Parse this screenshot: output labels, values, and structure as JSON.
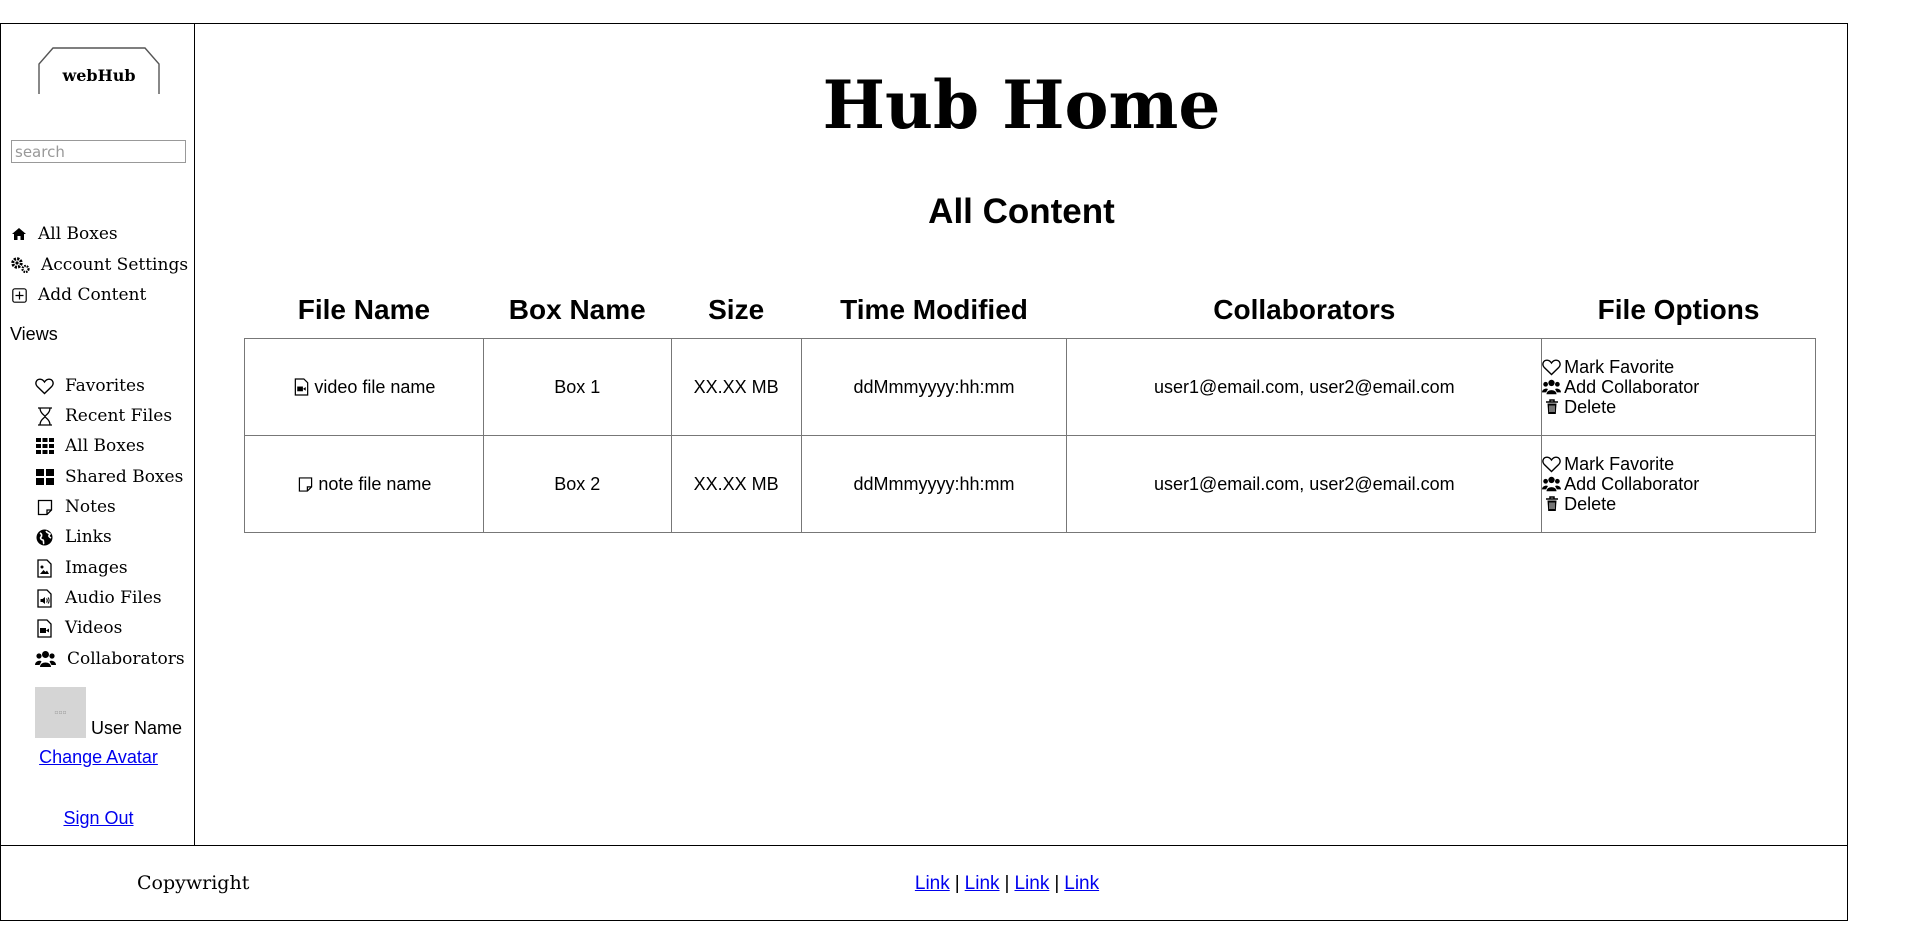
{
  "sidebar": {
    "logo_text": "webHub",
    "search_placeholder": "search",
    "nav": [
      {
        "label": "All Boxes",
        "icon": "home-icon"
      },
      {
        "label": "Account Settings",
        "icon": "gears-icon"
      },
      {
        "label": "Add Content",
        "icon": "plus-square-icon"
      }
    ],
    "views_label": "Views",
    "views": [
      {
        "label": "Favorites",
        "icon": "heart-icon"
      },
      {
        "label": "Recent Files",
        "icon": "hourglass-icon"
      },
      {
        "label": "All Boxes",
        "icon": "grid-icon"
      },
      {
        "label": "Shared Boxes",
        "icon": "large-grid-icon"
      },
      {
        "label": "Notes",
        "icon": "note-icon"
      },
      {
        "label": "Links",
        "icon": "globe-icon"
      },
      {
        "label": "Images",
        "icon": "image-file-icon"
      },
      {
        "label": "Audio Files",
        "icon": "audio-file-icon"
      },
      {
        "label": "Videos",
        "icon": "video-file-icon"
      },
      {
        "label": "Collaborators",
        "icon": "users-icon"
      }
    ],
    "user_name": "User Name",
    "change_avatar": "Change Avatar",
    "sign_out": "Sign Out"
  },
  "main": {
    "title": "Hub Home",
    "section_title": "All Content",
    "columns": [
      "File Name",
      "Box Name",
      "Size",
      "Time Modified",
      "Collaborators",
      "File Options"
    ],
    "rows": [
      {
        "file_name": "video file name",
        "file_icon": "video-file-icon",
        "box": "Box 1",
        "size": "XX.XX MB",
        "modified": "ddMmmyyyy:hh:mm",
        "collaborators": "user1@email.com, user2@email.com"
      },
      {
        "file_name": "note file name",
        "file_icon": "note-icon",
        "box": "Box 2",
        "size": "XX.XX MB",
        "modified": "ddMmmyyyy:hh:mm",
        "collaborators": "user1@email.com, user2@email.com"
      }
    ],
    "options": [
      "Mark Favorite",
      "Add Collaborator",
      "Delete"
    ]
  },
  "footer": {
    "copyright": "Copywright",
    "links": [
      "Link",
      "Link",
      "Link",
      "Link"
    ],
    "separator": "|"
  }
}
